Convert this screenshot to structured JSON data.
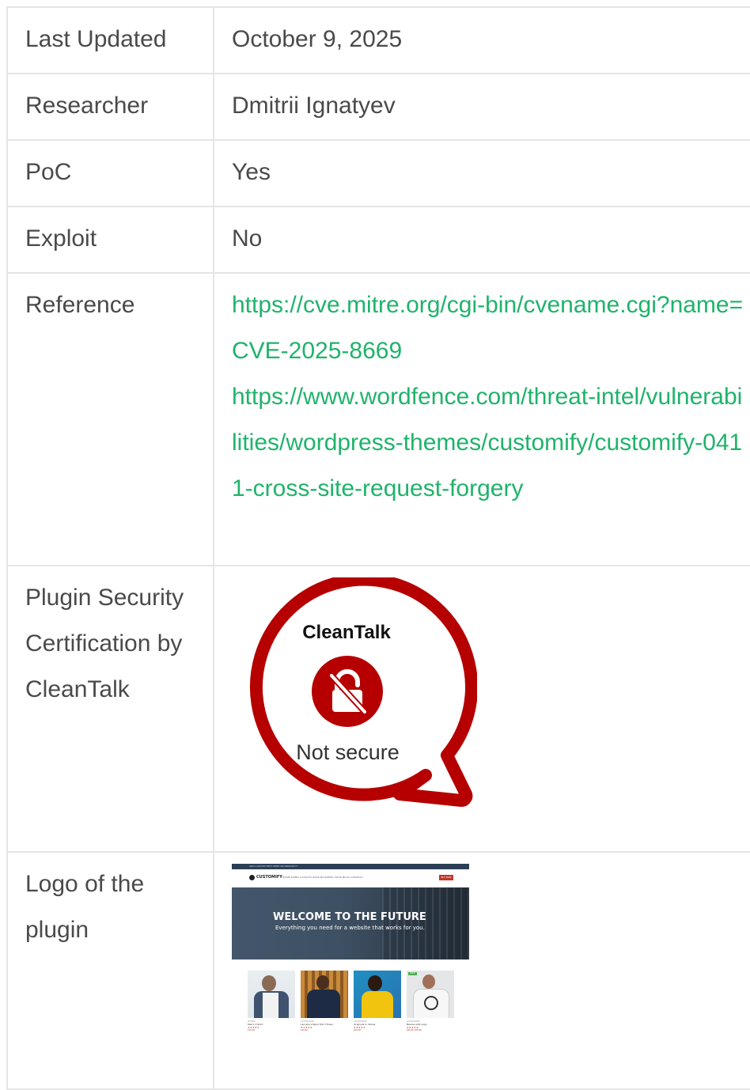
{
  "rows": [
    {
      "key": "Last Updated",
      "value": "October 9, 2025"
    },
    {
      "key": "Researcher",
      "value": "Dmitrii Ignatyev"
    },
    {
      "key": "PoC",
      "value": "Yes"
    },
    {
      "key": "Exploit",
      "value": "No"
    }
  ],
  "reference": {
    "key": "Reference",
    "links": [
      "https://cve.mitre.org/cgi-bin/cvename.cgi?name=CVE-2025-8669",
      "https://www.wordfence.com/threat-intel/vulnerabilities/wordpress-themes/customify/customify-0411-cross-site-request-forgery"
    ]
  },
  "certification": {
    "key": "Plugin Security Certification by CleanTalk",
    "badge_brand": "CleanTalk",
    "badge_status": "Not secure",
    "badge_color": "#b60000",
    "badge_icon": "unlock-slash-icon"
  },
  "logo": {
    "key": "Logo of the plugin",
    "preview": {
      "topbar_text": "ADD CUSTOM TEXT HERE OR REMOVE IT",
      "brand": "CUSTOMIFY",
      "nav": "HOME   DEMO LAYOUTS   PAGE BUILDERS   SHOP   BLOG   CONTACT",
      "buy_label": "BUY NOW",
      "hero_title": "WELCOME TO THE FUTURE",
      "hero_subtitle": "Everything you need for a website that works for you.",
      "sale_label": "SALE",
      "products": [
        {
          "tag": "WOMEN",
          "name": "Men's T-Shirt",
          "stars": "★★★★★",
          "price": "$19.00"
        },
        {
          "tag": "ACCESSORIES",
          "name": "Lacoste V-Neck Polo Flower",
          "stars": "★★★★★",
          "price": "$29.00"
        },
        {
          "tag": "ACCESSORIES",
          "name": "Originals in Yellow",
          "stars": "★★★★★",
          "price": "$29.00"
        },
        {
          "tag": "ACCESSORIES",
          "name": "Beanie with Logo",
          "stars": "★★★★★",
          "price": "$20.00 $18.00"
        }
      ]
    }
  }
}
